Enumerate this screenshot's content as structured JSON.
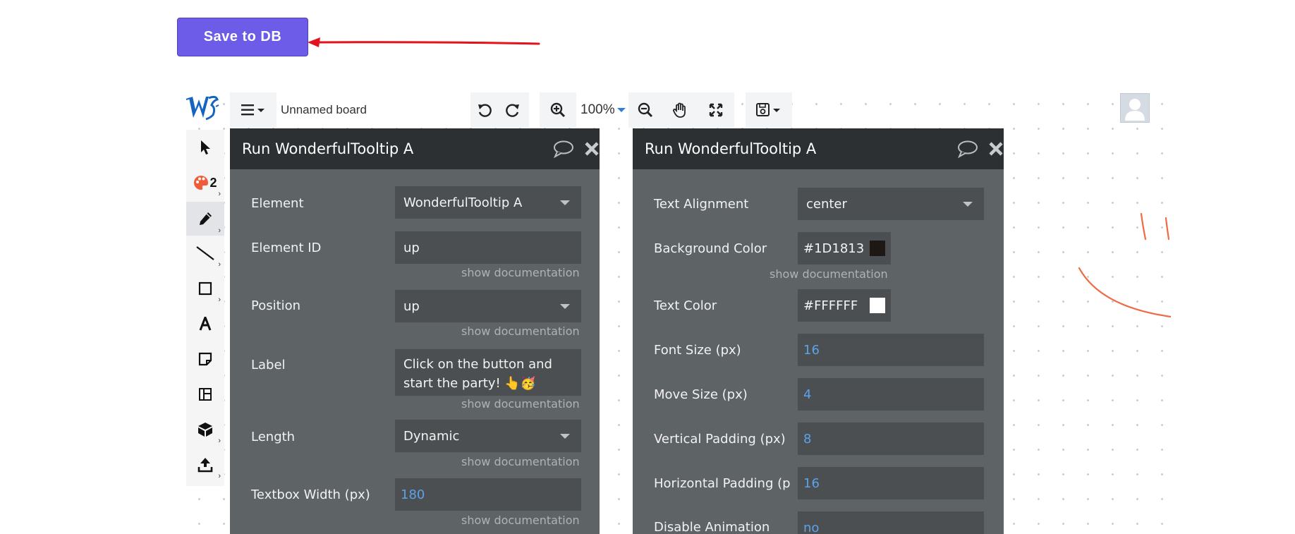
{
  "save_button": {
    "label": "Save to DB"
  },
  "toolbar": {
    "board_name": "Unnamed board",
    "zoom": "100%"
  },
  "left_tools": {
    "palette_count": "2"
  },
  "panel_left": {
    "title": "Run WonderfulTooltip A",
    "fields": {
      "element": {
        "label": "Element",
        "value": "WonderfulTooltip A"
      },
      "element_id": {
        "label": "Element ID",
        "value": "up"
      },
      "position": {
        "label": "Position",
        "value": "up"
      },
      "label": {
        "label": "Label",
        "value": "Click on the button and start the party! 👆🥳"
      },
      "length": {
        "label": "Length",
        "value": "Dynamic"
      },
      "textbox_width": {
        "label": "Textbox Width (px)",
        "value": "180"
      }
    },
    "doc_link": "show documentation"
  },
  "panel_right": {
    "title": "Run WonderfulTooltip A",
    "fields": {
      "text_alignment": {
        "label": "Text Alignment",
        "value": "center"
      },
      "background_color": {
        "label": "Background Color",
        "value": "#1D1813",
        "swatch": "#1D1813"
      },
      "text_color": {
        "label": "Text Color",
        "value": "#FFFFFF",
        "swatch": "#FFFFFF"
      },
      "font_size": {
        "label": "Font Size (px)",
        "value": "16"
      },
      "move_size": {
        "label": "Move Size (px)",
        "value": "4"
      },
      "vertical_padding": {
        "label": "Vertical Padding (px)",
        "value": "8"
      },
      "horizontal_padding": {
        "label": "Horizontal Padding (p",
        "value": "16"
      },
      "disable_animation": {
        "label": "Disable Animation",
        "value": "no"
      }
    },
    "doc_link": "show documentation"
  },
  "colors": {
    "accent": "#6c5ce7",
    "arrow": "#e3121b",
    "panel_header": "#2c3033",
    "panel_body": "#5e6366",
    "field_bg": "#4b4f52",
    "number_text": "#5da2e8",
    "drawing": "#f06a45"
  }
}
